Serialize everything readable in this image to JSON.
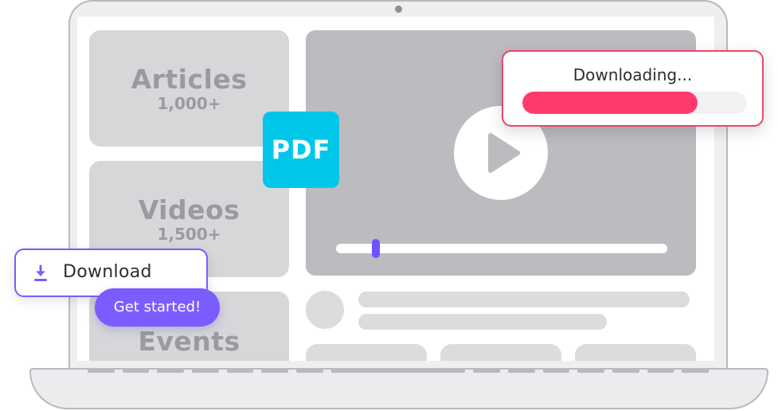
{
  "cards": [
    {
      "title": "Articles",
      "count": "1,000+"
    },
    {
      "title": "Videos",
      "count": "1,500+"
    },
    {
      "title": "Events",
      "count": ""
    }
  ],
  "pdf_badge": {
    "label": "PDF",
    "color": "#00c6ea"
  },
  "downloading_popup": {
    "label": "Downloading...",
    "progress": 0.78,
    "fill_color": "#ff3b6b",
    "border_color": "#f0456a"
  },
  "video_player": {
    "play_icon": "play-icon",
    "scrub_position": 0.12,
    "scrub_color": "#6f52ff"
  },
  "download_button": {
    "label": "Download",
    "icon": "download-icon",
    "accent": "#7b5cff"
  },
  "get_started_button": {
    "label": "Get started!",
    "color": "#7b5cff"
  }
}
